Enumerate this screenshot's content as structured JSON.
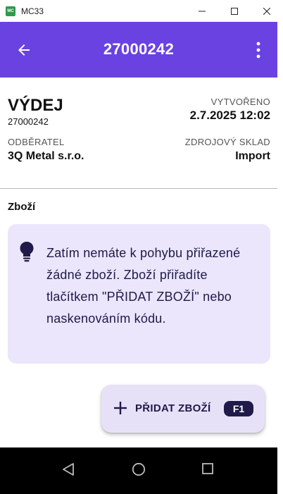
{
  "window": {
    "title": "MC33",
    "icon_text": "MC"
  },
  "appbar": {
    "title": "27000242",
    "color": "#6a42e2"
  },
  "document": {
    "type": "VÝDEJ",
    "number": "27000242",
    "created_label": "VYTVOŘENO",
    "created_value": "2.7.2025 12:02",
    "customer_label": "ODBĚRATEL",
    "customer_value": "3Q Metal s.r.o.",
    "source_label": "ZDROJOVÝ SKLAD",
    "source_value": "Import"
  },
  "goods": {
    "section_title": "Zboží",
    "info_text": "Zatím nemáte k pohybu přiřazené žádné zboží. Zboží přiřadíte tlačítkem \"PŘIDAT ZBOŽÍ\" nebo naskenováním kódu."
  },
  "fab": {
    "label": "PŘIDAT ZBOŽÍ",
    "shortcut": "F1"
  },
  "icons": {
    "back": "arrow-left-icon",
    "menu": "more-vert-icon",
    "info": "lightbulb-icon",
    "add": "plus-icon"
  }
}
